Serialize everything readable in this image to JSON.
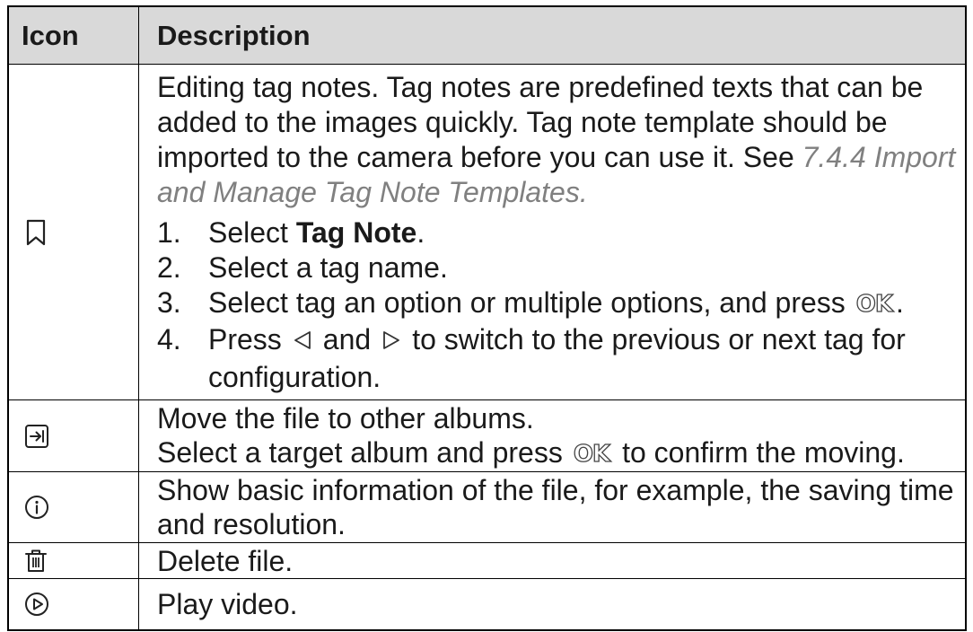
{
  "colors": {
    "header_bg": "#d9d9d9",
    "border": "#000000",
    "text": "#1a1a1a",
    "link": "#808080"
  },
  "header": {
    "icon": "Icon",
    "description": "Description"
  },
  "ok_key_label": "OK",
  "rows": [
    {
      "icon": "bookmark-icon",
      "intro_lines": [
        "Editing tag notes. Tag notes are predefined texts that can be",
        "added to the images quickly. Tag note template should be"
      ],
      "ref_lead": "imported to the camera before you can use it. See ",
      "ref_link_line1": "7.4.4 Import",
      "ref_link_line2": "and Manage Tag Note Templates.",
      "steps": [
        {
          "num": "1.",
          "before": "Select ",
          "bold": "Tag Note",
          "after": "."
        },
        {
          "num": "2.",
          "text": "Select a tag name."
        },
        {
          "num": "3.",
          "before": "Select tag an option or multiple options, and press",
          "key_icon": "ok-key-icon",
          "after": "."
        },
        {
          "num": "4.",
          "before": "Press",
          "key_icon_1": "left-key-icon",
          "middle": "and",
          "key_icon_2": "right-key-icon",
          "after": "to switch to the previous or next tag for",
          "continuation": "configuration."
        }
      ]
    },
    {
      "icon": "move-to-album-icon",
      "line1": "Move the file to other albums.",
      "line2_before": "Select a target album and press",
      "key_icon": "ok-key-icon",
      "line2_after": "to confirm the moving."
    },
    {
      "icon": "info-icon",
      "lines": [
        "Show basic information of the file, for example, the saving time",
        "and resolution."
      ]
    },
    {
      "icon": "trash-icon",
      "lines": [
        "Delete file."
      ]
    },
    {
      "icon": "play-icon",
      "lines": [
        "Play video."
      ]
    }
  ]
}
